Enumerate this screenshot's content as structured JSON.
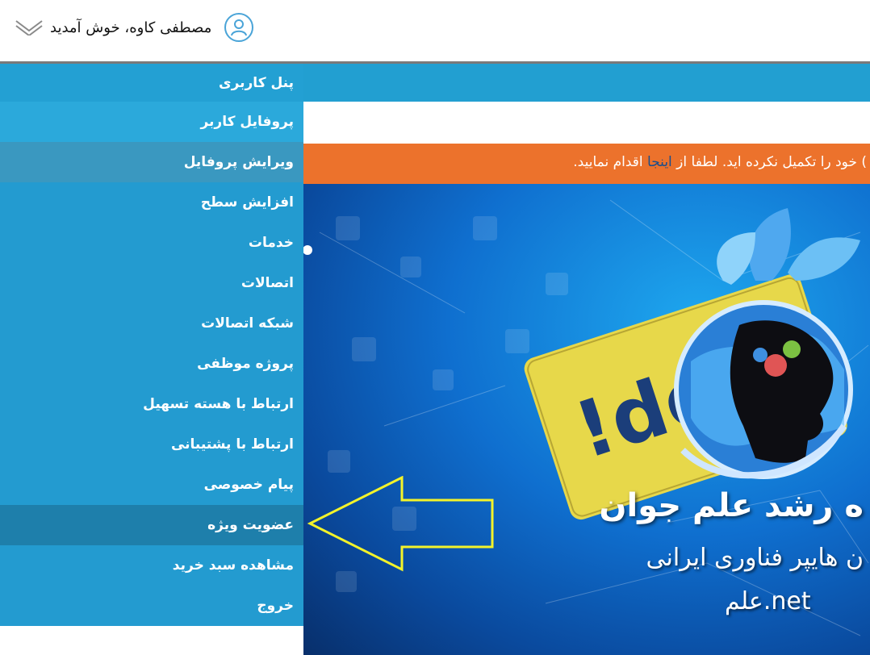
{
  "header": {
    "welcome": "مصطفی کاوه، خوش آمدید",
    "avatar_icon": "user-circle-icon",
    "toggle_icon": "chevron-down-icon"
  },
  "notice": {
    "text_before": ") خود را تکمیل نکرده اید. لطفا از ",
    "link": "اینجا",
    "text_after": " اقدام نمایید."
  },
  "menu": {
    "items": [
      {
        "label": "پنل کاربری"
      },
      {
        "label": "پروفایل کاربر"
      },
      {
        "label": "ویرایش پروفایل"
      },
      {
        "label": "افزایش سطح"
      },
      {
        "label": "خدمات"
      },
      {
        "label": "اتصالات"
      },
      {
        "label": "شبکه اتصالات"
      },
      {
        "label": "پروژه موظفی"
      },
      {
        "label": "ارتباط با هسته تسهیل"
      },
      {
        "label": "ارتباط با پشتیبانی"
      },
      {
        "label": "پیام خصوصی"
      },
      {
        "label": "عضویت ویژه"
      },
      {
        "label": "مشاهده سبد خرید"
      },
      {
        "label": "خروج"
      }
    ]
  },
  "hero": {
    "title": "ه رشد علم جوان",
    "subtitle": "ن هایپر فناوری ایرانی",
    "url": "علم.net",
    "card_text": "!de"
  },
  "colors": {
    "menu_bg": "#239bd0",
    "orange": "#ec722c",
    "highlight_arrow": "#f3f32a"
  }
}
